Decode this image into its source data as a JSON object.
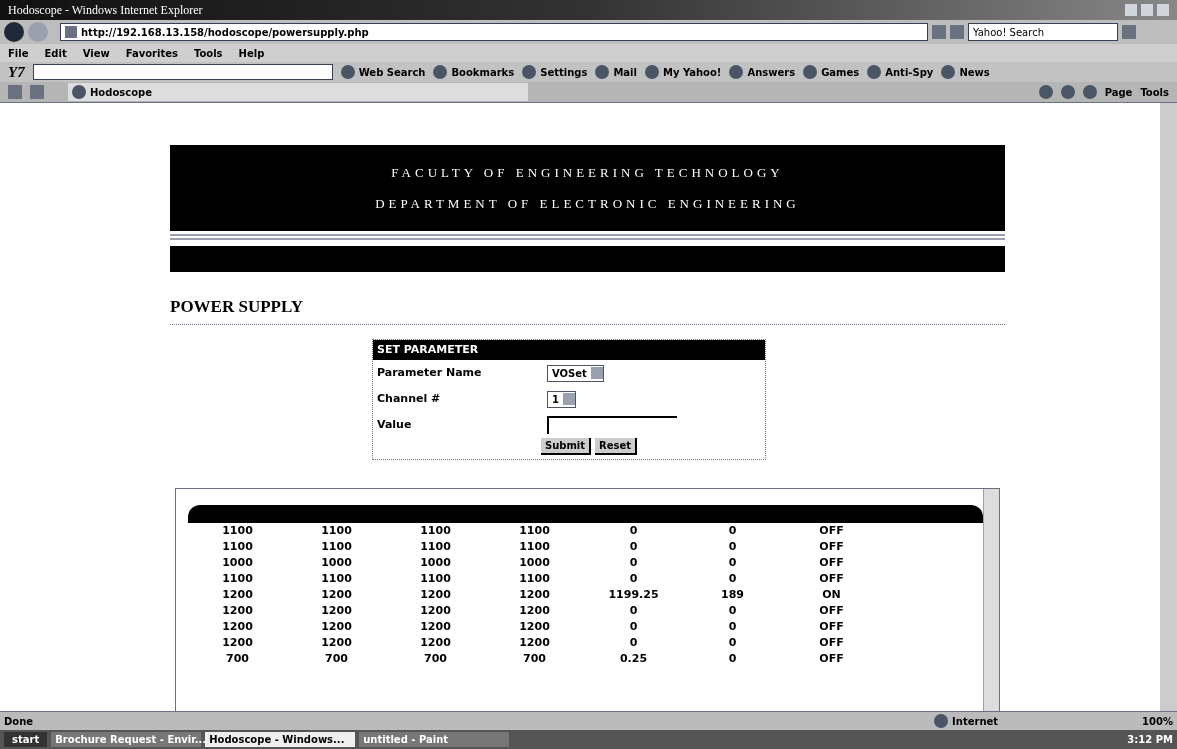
{
  "window": {
    "title": "Hodoscope - Windows Internet Explorer"
  },
  "address_bar": {
    "url": "http://192.168.13.158/hodoscope/powersupply.php",
    "search_placeholder": "Yahoo! Search"
  },
  "menu": [
    "File",
    "Edit",
    "View",
    "Favorites",
    "Tools",
    "Help"
  ],
  "yahoo_toolbar": {
    "logo": "Y7",
    "items": [
      "Web Search",
      "Bookmarks",
      "Settings",
      "Mail",
      "My Yahoo!",
      "Answers",
      "Games",
      "Anti-Spy",
      "News"
    ]
  },
  "tab": {
    "label": "Hodoscope"
  },
  "command_bar": [
    "Page",
    "Tools"
  ],
  "page": {
    "header": [
      "FACULTY OF ENGINEERING TECHNOLOGY",
      "DEPARTMENT OF ELECTRONIC ENGINEERING"
    ],
    "title": "POWER SUPPLY",
    "form": {
      "title": "SET PARAMETER",
      "fields": [
        {
          "label": "Parameter Name",
          "kind": "select",
          "value": "VOSet"
        },
        {
          "label": "Channel #",
          "kind": "select",
          "value": "1"
        },
        {
          "label": "Value",
          "kind": "input"
        }
      ],
      "buttons": [
        "Submit",
        "Reset"
      ]
    },
    "table": {
      "rows": [
        [
          "1100",
          "1100",
          "1100",
          "1100",
          "0",
          "0",
          "OFF"
        ],
        [
          "1100",
          "1100",
          "1100",
          "1100",
          "0",
          "0",
          "OFF"
        ],
        [
          "1000",
          "1000",
          "1000",
          "1000",
          "0",
          "0",
          "OFF"
        ],
        [
          "1100",
          "1100",
          "1100",
          "1100",
          "0",
          "0",
          "OFF"
        ],
        [
          "1200",
          "1200",
          "1200",
          "1200",
          "1199.25",
          "189",
          "ON"
        ],
        [
          "1200",
          "1200",
          "1200",
          "1200",
          "0",
          "0",
          "OFF"
        ],
        [
          "1200",
          "1200",
          "1200",
          "1200",
          "0",
          "0",
          "OFF"
        ],
        [
          "1200",
          "1200",
          "1200",
          "1200",
          "0",
          "0",
          "OFF"
        ],
        [
          "700",
          "700",
          "700",
          "700",
          "0.25",
          "0",
          "OFF"
        ]
      ]
    }
  },
  "status_bar": {
    "text": "Done",
    "zone": "Internet",
    "zoom": "100%"
  },
  "taskbar": {
    "start": "start",
    "tasks": [
      {
        "label": "Brochure Request - Envir...",
        "selected": false
      },
      {
        "label": "Hodoscope - Windows...",
        "selected": true
      },
      {
        "label": "untitled - Paint",
        "selected": false
      }
    ],
    "clock": "3:12 PM"
  }
}
